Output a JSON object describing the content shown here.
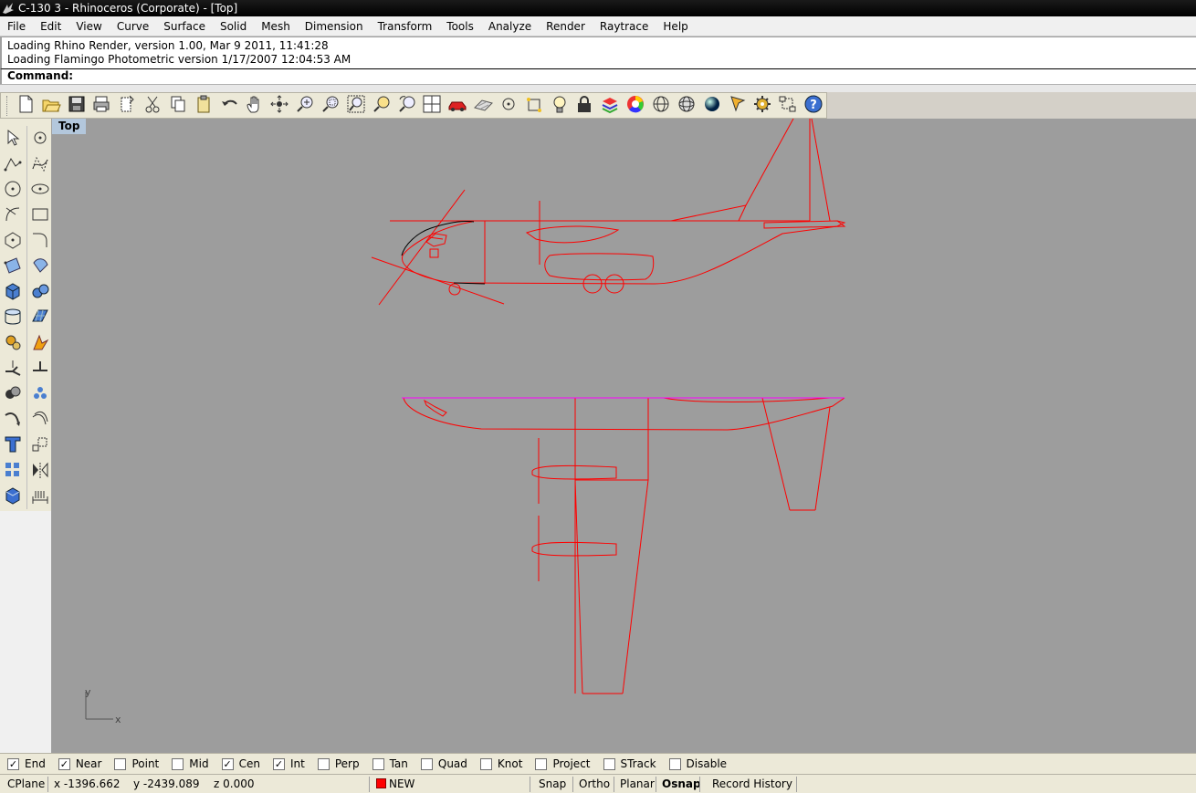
{
  "window": {
    "title": "C-130 3 - Rhinoceros (Corporate) - [Top]"
  },
  "menu": [
    "File",
    "Edit",
    "View",
    "Curve",
    "Surface",
    "Solid",
    "Mesh",
    "Dimension",
    "Transform",
    "Tools",
    "Analyze",
    "Render",
    "Raytrace",
    "Help"
  ],
  "command_history": [
    "Loading Rhino Render, version 1.00, Mar  9 2011, 11:41:28",
    "Loading Flamingo Photometric version 1/17/2007 12:04:53 AM"
  ],
  "command": {
    "label": "Command:",
    "value": ""
  },
  "standard_toolbar": [
    "new-icon",
    "open-icon",
    "save-icon",
    "print-icon",
    "import-icon",
    "cut-icon",
    "copy-icon",
    "paste-icon",
    "undo-icon",
    "pan-hand-icon",
    "rotate-view-icon",
    "zoom-dynamic-icon",
    "zoom-window-icon",
    "zoom-extents-icon",
    "zoom-selected-icon",
    "undo-view-icon",
    "four-viewports-icon",
    "car-render-icon",
    "plane-icon",
    "point-icon",
    "snap-points-icon",
    "light-icon",
    "lock-icon",
    "layer-icon",
    "color-wheel-icon",
    "wireframe-sphere-icon",
    "grid-sphere-icon",
    "rendered-sphere-icon",
    "object-properties-icon",
    "settings-gear-icon",
    "history-icon",
    "help-icon"
  ],
  "left_toolbar": [
    [
      "select-arrow-icon",
      "point-icon"
    ],
    [
      "polyline-icon",
      "curve-icon"
    ],
    [
      "circle-icon",
      "ellipse-icon"
    ],
    [
      "arc-icon",
      "rectangle-icon"
    ],
    [
      "polygon-icon",
      "fillet-curve-icon"
    ],
    [
      "surface-from-points-icon",
      "revolve-icon"
    ],
    [
      "box-icon",
      "sphere-group-icon"
    ],
    [
      "cylinder-icon",
      "planar-surface-icon"
    ],
    [
      "transform-gears-icon",
      "explode-icon"
    ],
    [
      "split-icon",
      "trim-icon"
    ],
    [
      "boolean-icon",
      "group-icon"
    ],
    [
      "move-curve-icon",
      "offset-curve-icon"
    ],
    [
      "text-icon",
      "scale-icon"
    ],
    [
      "array-icon",
      "mirror-icon"
    ],
    [
      "render-box-icon",
      "dimension-icon"
    ]
  ],
  "viewport": {
    "name": "Top",
    "axis_x": "x",
    "axis_y": "y"
  },
  "osnaps": [
    {
      "label": "End",
      "checked": true
    },
    {
      "label": "Near",
      "checked": true
    },
    {
      "label": "Point",
      "checked": false
    },
    {
      "label": "Mid",
      "checked": false
    },
    {
      "label": "Cen",
      "checked": true
    },
    {
      "label": "Int",
      "checked": true
    },
    {
      "label": "Perp",
      "checked": false
    },
    {
      "label": "Tan",
      "checked": false
    },
    {
      "label": "Quad",
      "checked": false
    },
    {
      "label": "Knot",
      "checked": false
    },
    {
      "label": "Project",
      "checked": false
    },
    {
      "label": "STrack",
      "checked": false
    },
    {
      "label": "Disable",
      "checked": false
    }
  ],
  "status": {
    "cplane": "CPlane",
    "x": "x -1396.662",
    "y": "y -2439.089",
    "z": "z 0.000",
    "layer": "NEW",
    "layer_color": "#ff0000",
    "snap": "Snap",
    "ortho": "Ortho",
    "planar": "Planar",
    "osnap": "Osnap",
    "record_history": "Record History"
  },
  "colors": {
    "viewport_bg": "#9d9d9d",
    "curve": "#ff0000",
    "selected_edge": "#ff00ff",
    "toolbar_bg": "#ece9d8"
  }
}
